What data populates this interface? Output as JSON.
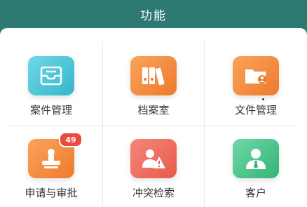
{
  "header": {
    "title": "功能"
  },
  "grid": {
    "items": [
      {
        "label": "案件管理",
        "icon": "inbox-tray-icon",
        "color": "#4fc6d8"
      },
      {
        "label": "档案室",
        "icon": "binders-icon",
        "color": "#f28a3c"
      },
      {
        "label": "文件管理",
        "icon": "folder-user-icon",
        "color": "#f28a3c"
      },
      {
        "label": "申请与审批",
        "icon": "stamp-icon",
        "color": "#f28a3c",
        "badge": "49"
      },
      {
        "label": "冲突检索",
        "icon": "conflict-warning-icon",
        "color": "#ef6b5a"
      },
      {
        "label": "客户",
        "icon": "client-person-icon",
        "color": "#4dc48e"
      }
    ]
  }
}
